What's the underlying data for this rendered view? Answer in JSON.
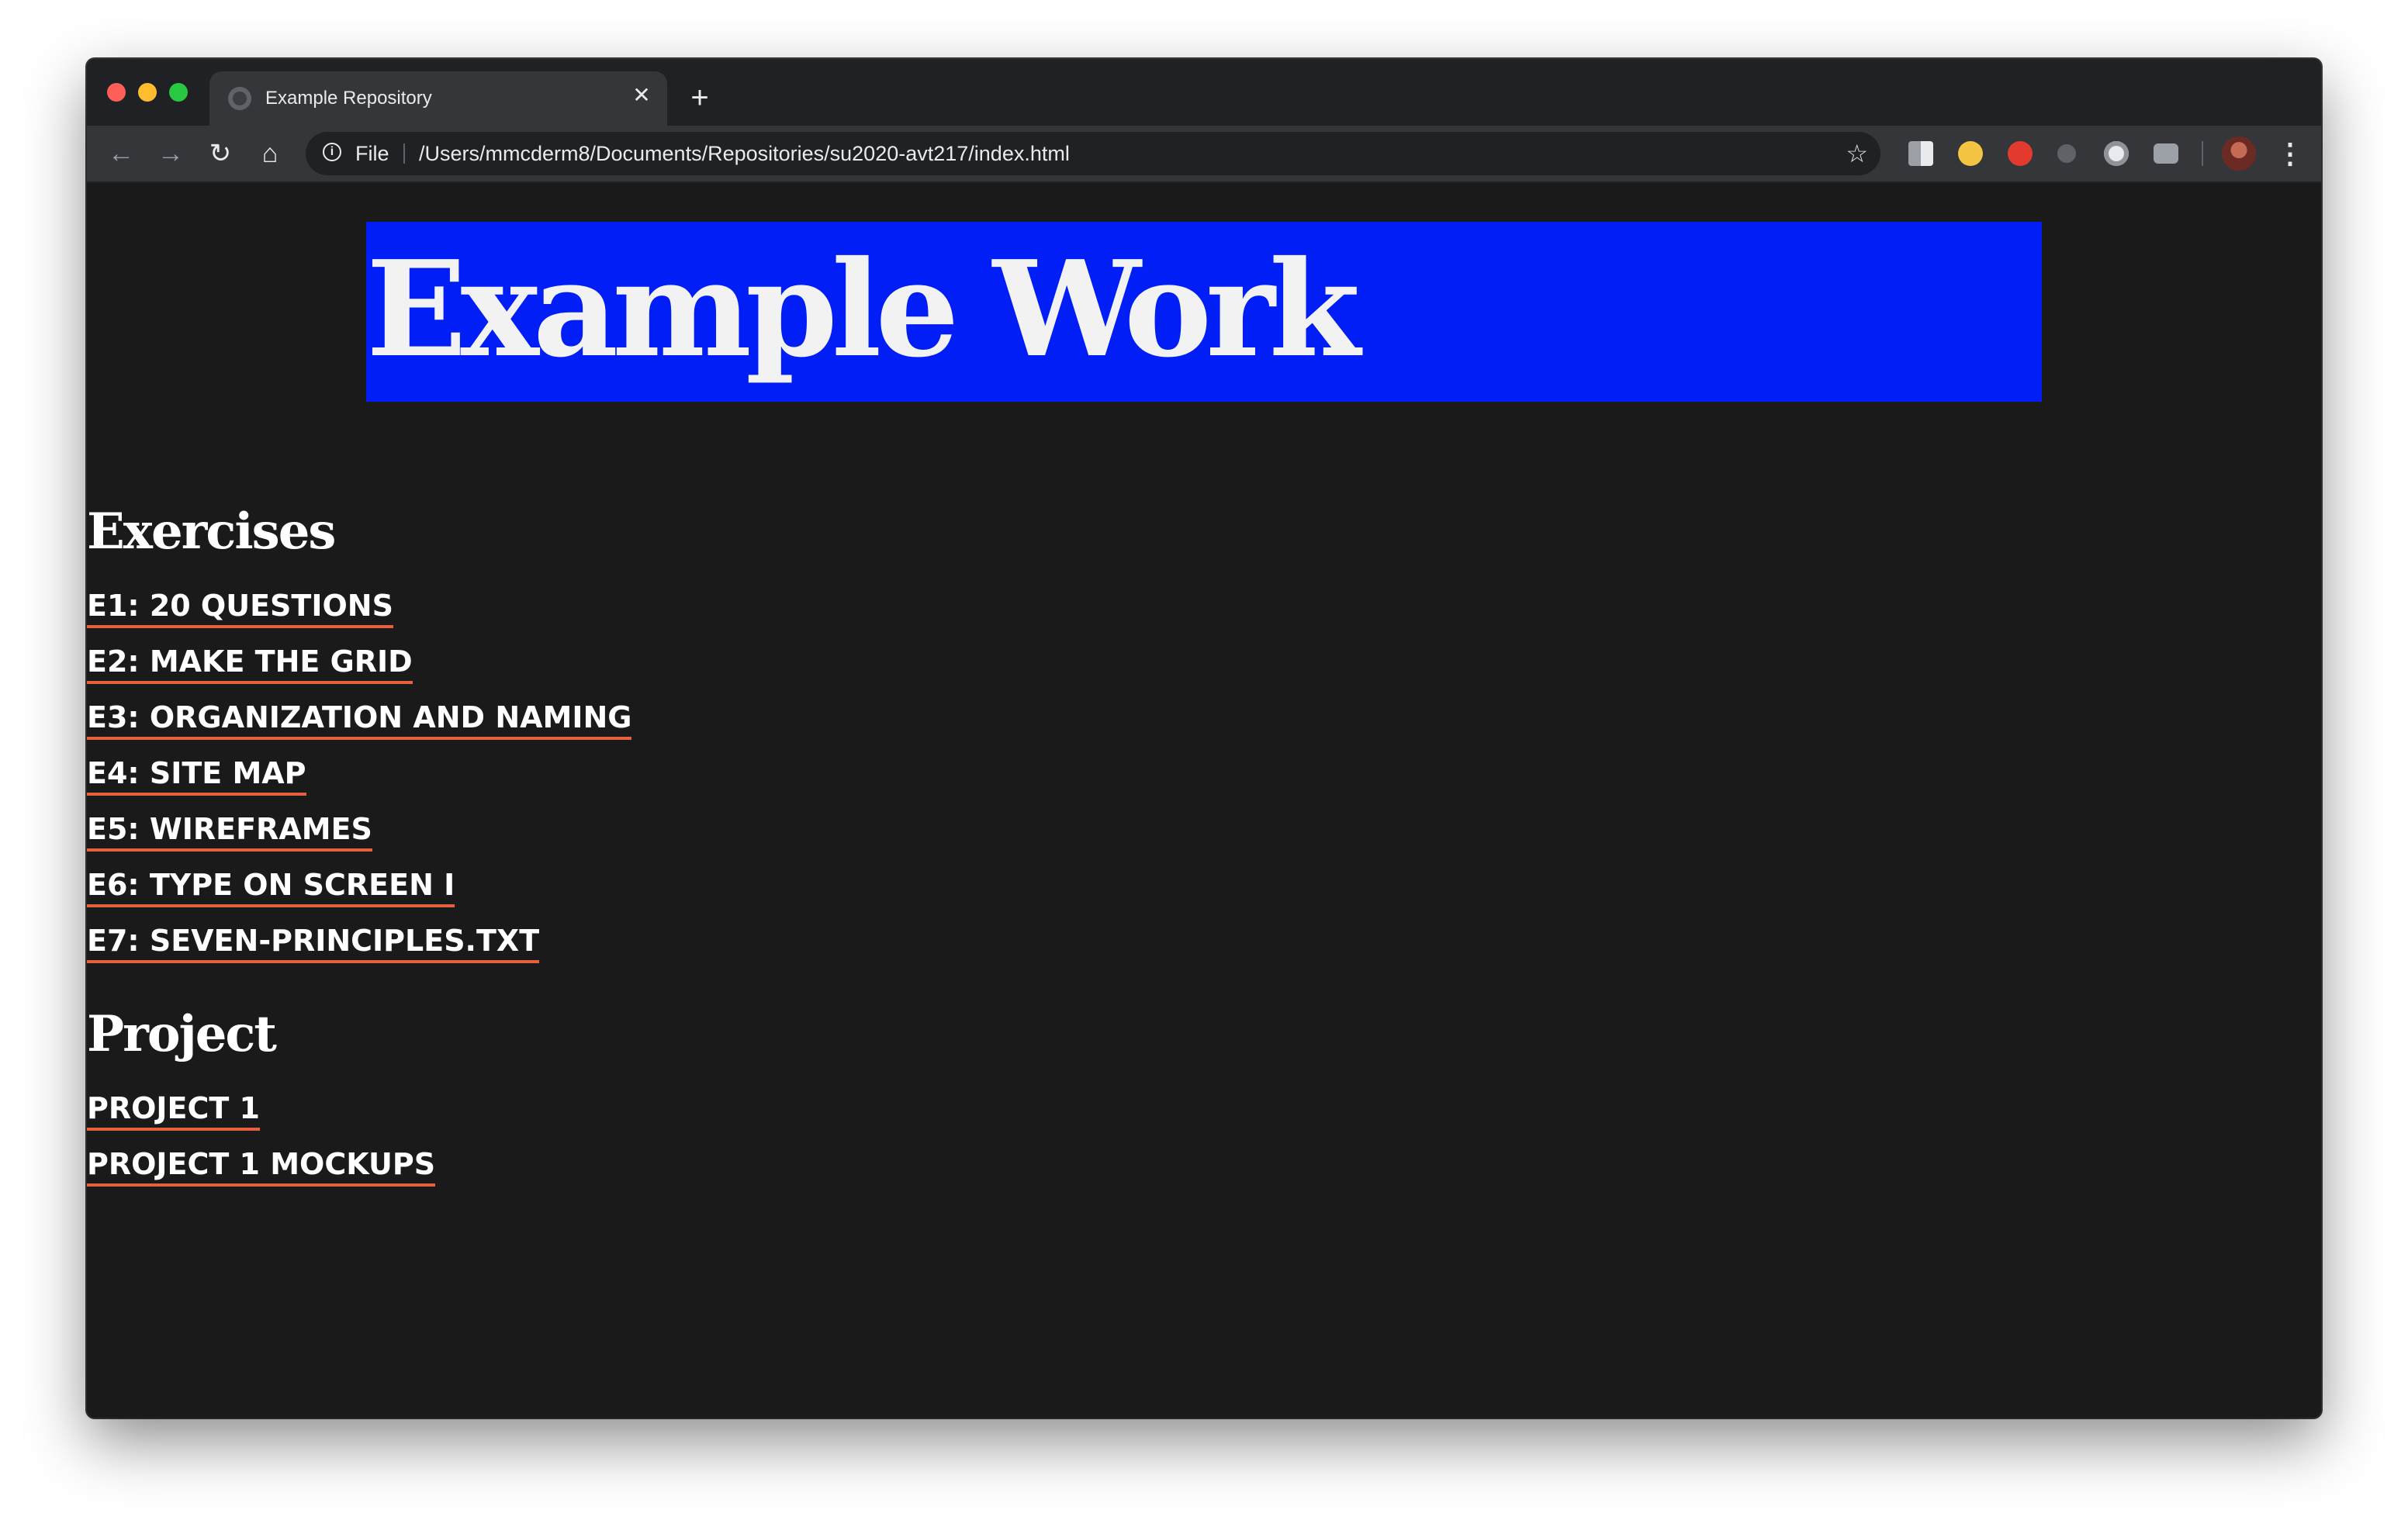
{
  "browser": {
    "tab": {
      "title": "Example Repository",
      "favicon": "globe-icon",
      "close_glyph": "✕"
    },
    "new_tab_glyph": "+",
    "toolbar": {
      "back_glyph": "←",
      "forward_glyph": "→",
      "reload_glyph": "↻",
      "home_glyph": "⌂",
      "info_glyph": "i",
      "scheme_label": "File",
      "url": "/Users/mmcderm8/Documents/Repositories/su2020-avt217/index.html",
      "star_glyph": "☆",
      "menu_glyph": "⋮"
    },
    "extensions": [
      "extension-tab-icon",
      "extension-emoji-icon",
      "extension-stop-icon",
      "extension-dot-icon",
      "extension-circle-icon",
      "extension-camera-icon"
    ]
  },
  "page": {
    "hero_title": "Example Work",
    "hero_color": "#001ef5",
    "accent_underline_color": "#e8613f",
    "background_color": "#1a1a1b",
    "sections": [
      {
        "heading": "Exercises",
        "links": [
          "E1: 20 QUESTIONS",
          "E2: MAKE THE GRID",
          "E3: ORGANIZATION AND NAMING",
          "E4: SITE MAP",
          "E5: WIREFRAMES",
          "E6: TYPE ON SCREEN I",
          "E7: SEVEN-PRINCIPLES.TXT"
        ]
      },
      {
        "heading": "Project",
        "links": [
          "PROJECT 1",
          "PROJECT 1 MOCKUPS"
        ]
      }
    ]
  }
}
